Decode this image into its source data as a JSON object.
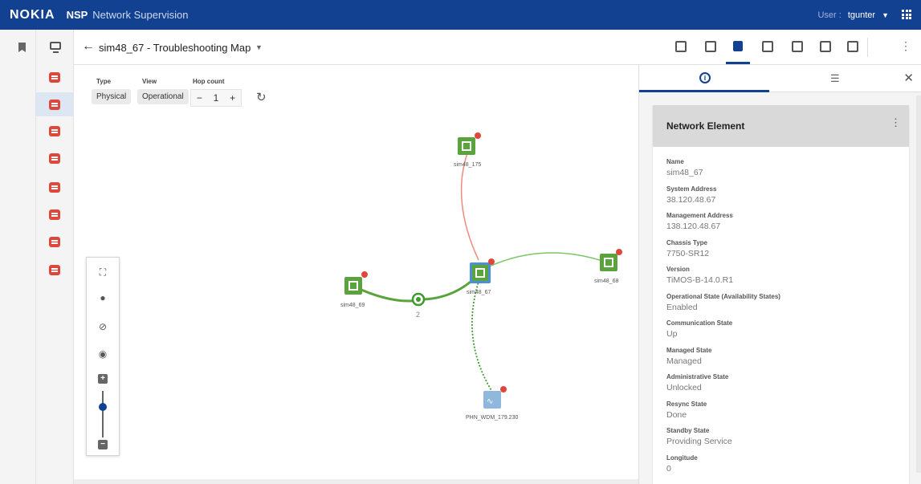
{
  "topbar": {
    "brand": "NOKIA",
    "product": "NSP",
    "app": "Network Supervision",
    "user_label": "User :",
    "user_name": "tgunter"
  },
  "header": {
    "map_title": "sim48_67 - Troubleshooting Map"
  },
  "filters": {
    "type_label": "Type",
    "type_value": "Physical",
    "view_label": "View",
    "view_value": "Operational",
    "hop_label": "Hop count",
    "hop_value": "1",
    "minus": "−",
    "plus": "+"
  },
  "map": {
    "nodes": {
      "sim48_175": "sim48_175",
      "sim48_69": "sim48_69",
      "sim48_67": "sim48_67",
      "sim48_68": "sim48_68",
      "phn": "PHN_WDM_179.230"
    },
    "aggregate_count": "2",
    "alarm_badge": "c",
    "colors": {
      "node": "#5ba33c",
      "selected": "#4a90d9",
      "link_up": "#7bc567",
      "link_down": "#ef8a7e",
      "alarm": "#e0473b",
      "optical": "#8fb8dc"
    }
  },
  "panel": {
    "card_title": "Network Element",
    "properties": [
      {
        "key": "Name",
        "value": "sim48_67"
      },
      {
        "key": "System Address",
        "value": "38.120.48.67"
      },
      {
        "key": "Management Address",
        "value": "138.120.48.67"
      },
      {
        "key": "Chassis Type",
        "value": "7750-SR12"
      },
      {
        "key": "Version",
        "value": "TiMOS-B-14.0.R1"
      },
      {
        "key": "Operational State (Availability States)",
        "value": "Enabled"
      },
      {
        "key": "Communication State",
        "value": "Up"
      },
      {
        "key": "Managed State",
        "value": "Managed"
      },
      {
        "key": "Administrative State",
        "value": "Unlocked"
      },
      {
        "key": "Resync State",
        "value": "Done"
      },
      {
        "key": "Standby State",
        "value": "Providing Service"
      },
      {
        "key": "Longitude",
        "value": "0"
      }
    ]
  }
}
